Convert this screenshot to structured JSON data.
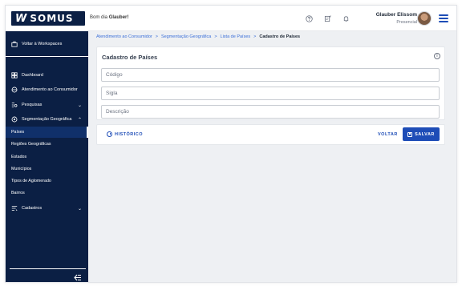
{
  "header": {
    "logo_mark": "W",
    "logo_text": "SOMUS",
    "greeting_prefix": "Bom dia",
    "greeting_name": "Glauber!",
    "user_name": "Glauber Elissom",
    "user_role": "Presencial",
    "icons": [
      "help-icon",
      "notes-icon",
      "bell-icon",
      "menu-icon"
    ]
  },
  "sidebar": {
    "workspace_label": "Voltar à Workspaces",
    "items": [
      {
        "label": "Dashboard",
        "icon": "dashboard-icon"
      },
      {
        "label": "Atendimento ao Consumidor",
        "icon": "support-icon"
      },
      {
        "label": "Pesquisas",
        "icon": "search-list-icon",
        "chevron": "⌄"
      },
      {
        "label": "Segmentação Geográfica",
        "icon": "globe-icon",
        "chevron": "⌃"
      }
    ],
    "sub_items": [
      {
        "label": "Países",
        "active": true
      },
      {
        "label": "Regiões Geográficas"
      },
      {
        "label": "Estados"
      },
      {
        "label": "Municípios"
      },
      {
        "label": "Tipos de Aglomerado"
      },
      {
        "label": "Bairros"
      }
    ],
    "cadastros": {
      "label": "Cadastros",
      "icon": "list-icon",
      "chevron": "⌄"
    },
    "collapse_icon": "collapse-icon"
  },
  "breadcrumb": {
    "items": [
      "Atendimento ao Consumidor",
      "Segmentação Geográfica",
      "Lista de Países"
    ],
    "current": "Cadastro de Países",
    "separator": ">"
  },
  "form": {
    "title": "Cadastro de Países",
    "fields": [
      {
        "placeholder": "Código",
        "value": ""
      },
      {
        "placeholder": "Sigla",
        "value": ""
      },
      {
        "placeholder": "Descrição",
        "value": ""
      }
    ]
  },
  "actions": {
    "history_label": "HISTÓRICO",
    "back_label": "VOLTAR",
    "save_label": "SALVAR"
  },
  "colors": {
    "sidebar_bg": "#0b1f44",
    "primary": "#1e4db7",
    "link": "#3b6fd8",
    "page_bg": "#eef0f3"
  }
}
